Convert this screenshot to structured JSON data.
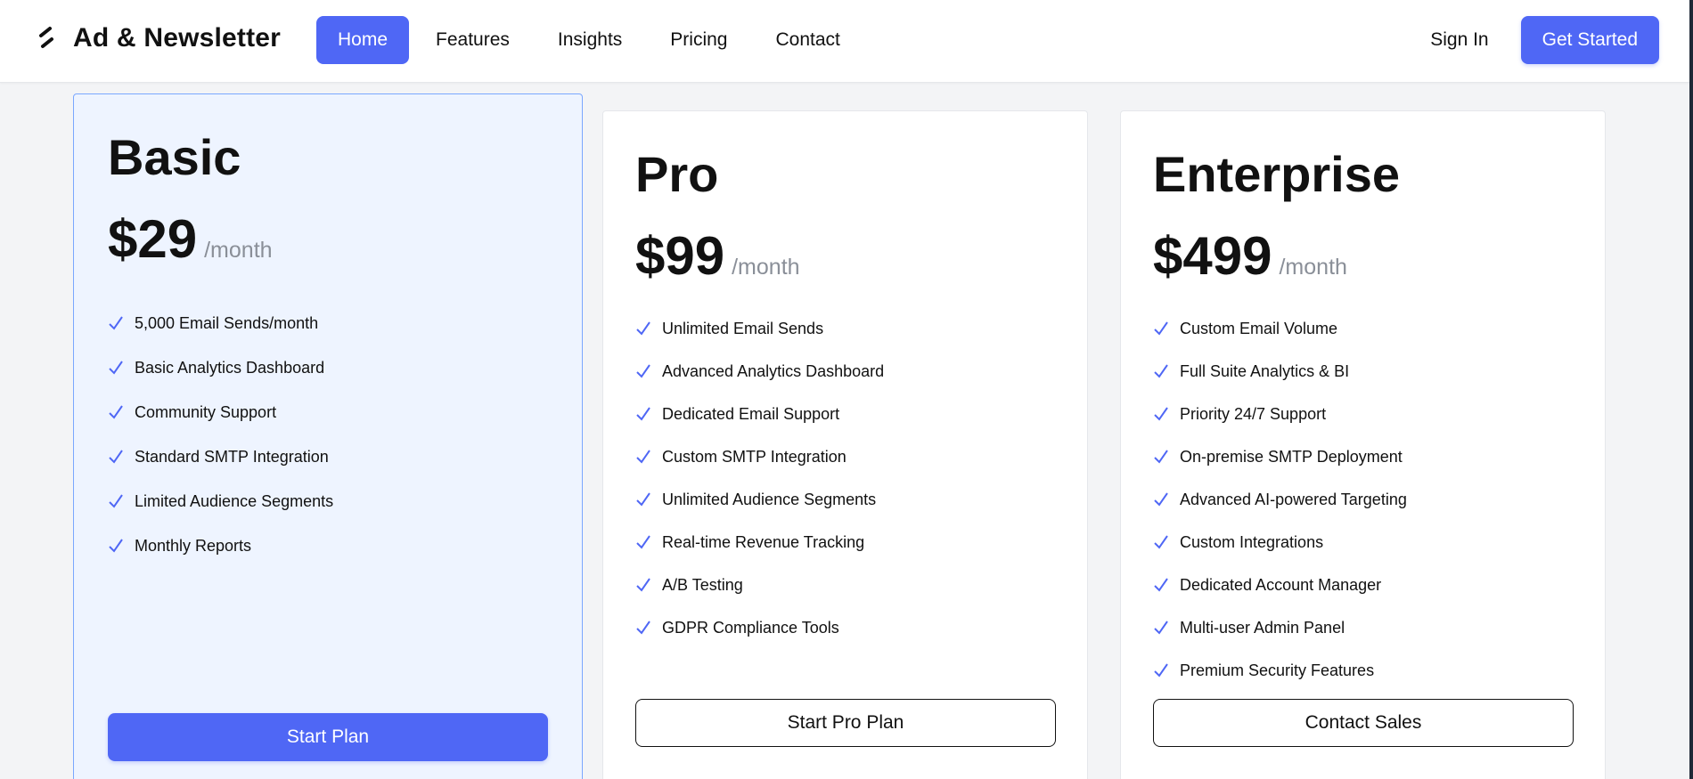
{
  "brand": {
    "name": "Ad & Newsletter",
    "logo_icon": "bolt-icon"
  },
  "nav": {
    "items": [
      {
        "label": "Home",
        "active": true
      },
      {
        "label": "Features"
      },
      {
        "label": "Insights"
      },
      {
        "label": "Pricing"
      },
      {
        "label": "Contact"
      }
    ]
  },
  "auth": {
    "signin_label": "Sign In",
    "cta_label": "Get Started"
  },
  "colors": {
    "accent": "#4f67f5",
    "featured_bg": "#eef4ff",
    "featured_border": "#7aa7ff"
  },
  "plans": [
    {
      "name": "Basic",
      "price": "$29",
      "period": "/month",
      "features": [
        "5,000 Email Sends/month",
        "Basic Analytics Dashboard",
        "Community Support",
        "Standard SMTP Integration",
        "Limited Audience Segments",
        "Monthly Reports"
      ],
      "button_label": "Start Plan"
    },
    {
      "name": "Pro",
      "price": "$99",
      "period": "/month",
      "features": [
        "Unlimited Email Sends",
        "Advanced Analytics Dashboard",
        "Dedicated Email Support",
        "Custom SMTP Integration",
        "Unlimited Audience Segments",
        "Real-time Revenue Tracking",
        "A/B Testing",
        "GDPR Compliance Tools"
      ],
      "button_label": "Start Pro Plan"
    },
    {
      "name": "Enterprise",
      "price": "$499",
      "period": "/month",
      "features": [
        "Custom Email Volume",
        "Full Suite Analytics & BI",
        "Priority 24/7 Support",
        "On-premise SMTP Deployment",
        "Advanced AI-powered Targeting",
        "Custom Integrations",
        "Dedicated Account Manager",
        "Multi-user Admin Panel",
        "Premium Security Features"
      ],
      "button_label": "Contact Sales"
    }
  ]
}
